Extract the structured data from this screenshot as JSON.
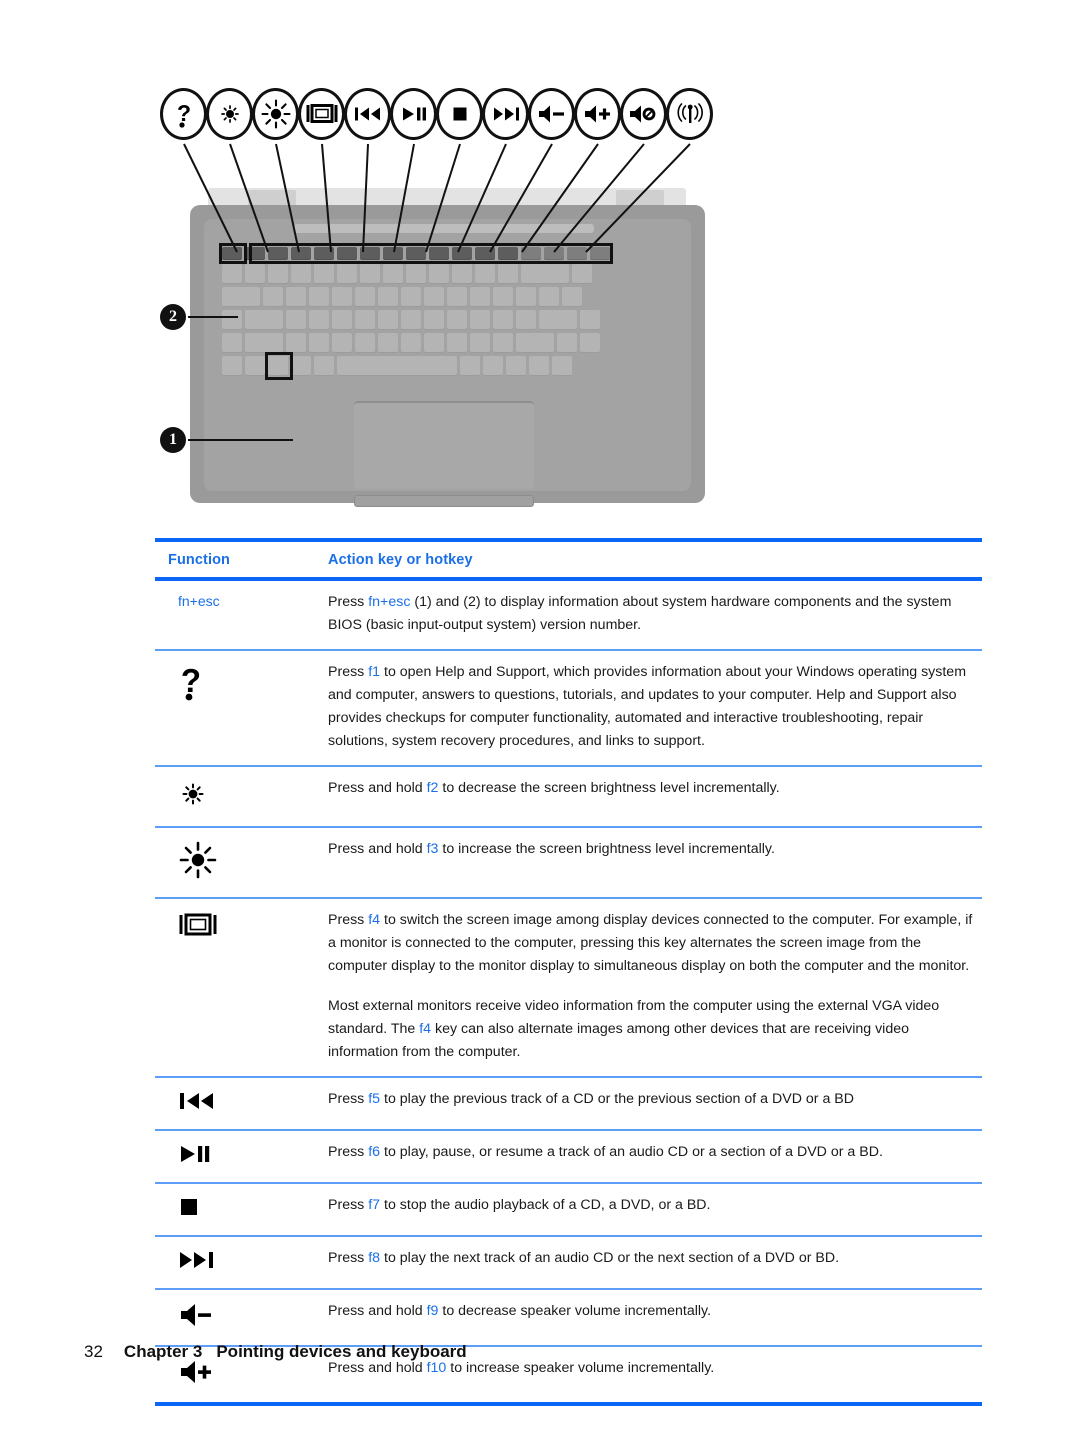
{
  "figure": {
    "caption_icons": [
      {
        "name": "help-question-icon",
        "glyph": "?"
      },
      {
        "name": "brightness-down-icon",
        "glyph": "sun-small"
      },
      {
        "name": "brightness-up-icon",
        "glyph": "sun-large"
      },
      {
        "name": "display-switch-icon",
        "glyph": "monitor"
      },
      {
        "name": "previous-track-icon",
        "glyph": "prev"
      },
      {
        "name": "play-pause-icon",
        "glyph": "playpause"
      },
      {
        "name": "stop-icon",
        "glyph": "stop"
      },
      {
        "name": "next-track-icon",
        "glyph": "next"
      },
      {
        "name": "volume-down-icon",
        "glyph": "vol-minus"
      },
      {
        "name": "volume-up-icon",
        "glyph": "vol-plus"
      },
      {
        "name": "mute-icon",
        "glyph": "vol-mute"
      },
      {
        "name": "wireless-icon",
        "glyph": "wireless"
      }
    ],
    "callouts": [
      {
        "number": "1",
        "target": "fn-key"
      },
      {
        "number": "2",
        "target": "action-key-row"
      }
    ]
  },
  "table": {
    "headers": {
      "function": "Function",
      "action": "Action key or hotkey"
    },
    "rows": [
      {
        "icon": "fn-esc-hotkey",
        "icon_label": "fn+esc",
        "paragraphs": [
          {
            "parts": [
              {
                "t": "Press ",
                "k": false
              },
              {
                "t": "fn+esc",
                "k": true
              },
              {
                "t": " (1) and (2) to display information about system hardware components and the system BIOS (basic input-output system) version number.",
                "k": false
              }
            ]
          }
        ]
      },
      {
        "icon": "help-question-icon",
        "icon_label": "",
        "paragraphs": [
          {
            "parts": [
              {
                "t": "Press ",
                "k": false
              },
              {
                "t": "f1",
                "k": true
              },
              {
                "t": " to open Help and Support, which provides information about your Windows operating system and computer, answers to questions, tutorials, and updates to your computer. Help and Support also provides checkups for computer functionality, automated and interactive troubleshooting, repair solutions, system recovery procedures, and links to support.",
                "k": false
              }
            ]
          }
        ]
      },
      {
        "icon": "brightness-down-icon",
        "icon_label": "",
        "paragraphs": [
          {
            "parts": [
              {
                "t": "Press and hold ",
                "k": false
              },
              {
                "t": "f2",
                "k": true
              },
              {
                "t": " to decrease the screen brightness level incrementally.",
                "k": false
              }
            ]
          }
        ]
      },
      {
        "icon": "brightness-up-icon",
        "icon_label": "",
        "paragraphs": [
          {
            "parts": [
              {
                "t": "Press and hold ",
                "k": false
              },
              {
                "t": "f3",
                "k": true
              },
              {
                "t": " to increase the screen brightness level incrementally.",
                "k": false
              }
            ]
          }
        ]
      },
      {
        "icon": "display-switch-icon",
        "icon_label": "",
        "paragraphs": [
          {
            "parts": [
              {
                "t": "Press ",
                "k": false
              },
              {
                "t": "f4",
                "k": true
              },
              {
                "t": " to switch the screen image among display devices connected to the computer. For example, if a monitor is connected to the computer, pressing this key alternates the screen image from the computer display to the monitor display to simultaneous display on both the computer and the monitor.",
                "k": false
              }
            ]
          },
          {
            "parts": [
              {
                "t": "Most external monitors receive video information from the computer using the external VGA video standard. The ",
                "k": false
              },
              {
                "t": "f4",
                "k": true
              },
              {
                "t": " key can also alternate images among other devices that are receiving video information from the computer.",
                "k": false
              }
            ]
          }
        ]
      },
      {
        "icon": "previous-track-icon",
        "icon_label": "",
        "paragraphs": [
          {
            "parts": [
              {
                "t": "Press ",
                "k": false
              },
              {
                "t": "f5",
                "k": true
              },
              {
                "t": " to play the previous track of a CD or the previous section of a DVD or a BD",
                "k": false
              }
            ]
          }
        ]
      },
      {
        "icon": "play-pause-icon",
        "icon_label": "",
        "paragraphs": [
          {
            "parts": [
              {
                "t": "Press ",
                "k": false
              },
              {
                "t": "f6",
                "k": true
              },
              {
                "t": " to play, pause, or resume a track of an audio CD or a section of a DVD or a BD.",
                "k": false
              }
            ]
          }
        ]
      },
      {
        "icon": "stop-icon",
        "icon_label": "",
        "paragraphs": [
          {
            "parts": [
              {
                "t": "Press ",
                "k": false
              },
              {
                "t": "f7",
                "k": true
              },
              {
                "t": " to stop the audio playback of a CD, a DVD, or a BD.",
                "k": false
              }
            ]
          }
        ]
      },
      {
        "icon": "next-track-icon",
        "icon_label": "",
        "paragraphs": [
          {
            "parts": [
              {
                "t": "Press ",
                "k": false
              },
              {
                "t": "f8",
                "k": true
              },
              {
                "t": " to play the next track of an audio CD or the next section of a DVD or BD.",
                "k": false
              }
            ]
          }
        ]
      },
      {
        "icon": "volume-down-icon",
        "icon_label": "",
        "paragraphs": [
          {
            "parts": [
              {
                "t": "Press and hold ",
                "k": false
              },
              {
                "t": "f9",
                "k": true
              },
              {
                "t": " to decrease speaker volume incrementally.",
                "k": false
              }
            ]
          }
        ]
      },
      {
        "icon": "volume-up-icon",
        "icon_label": "",
        "paragraphs": [
          {
            "parts": [
              {
                "t": "Press and hold ",
                "k": false
              },
              {
                "t": "f10",
                "k": true
              },
              {
                "t": " to increase speaker volume incrementally.",
                "k": false
              }
            ]
          }
        ]
      }
    ]
  },
  "footer": {
    "page_number": "32",
    "chapter": "Chapter 3",
    "title": "Pointing devices and keyboard"
  },
  "colors": {
    "rule_strong": "#0b66f5",
    "rule_light": "#5f9dfa",
    "link_blue": "#1a6fe8",
    "text": "#1a1a1a"
  }
}
